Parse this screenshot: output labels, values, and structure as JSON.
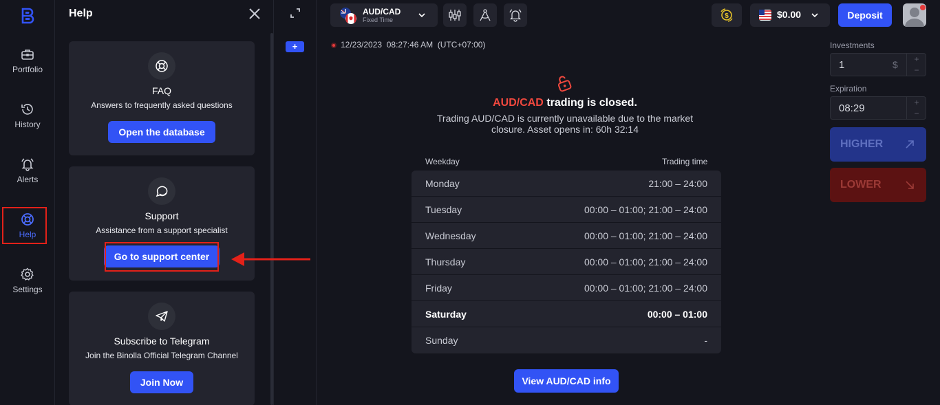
{
  "nav": {
    "items": [
      {
        "label": "Portfolio",
        "icon": "briefcase-icon"
      },
      {
        "label": "History",
        "icon": "history-icon"
      },
      {
        "label": "Alerts",
        "icon": "bell-icon"
      },
      {
        "label": "Help",
        "icon": "lifebuoy-icon"
      },
      {
        "label": "Settings",
        "icon": "gear-icon"
      }
    ]
  },
  "help_panel": {
    "title": "Help",
    "faq": {
      "title": "FAQ",
      "subtitle": "Answers to frequently asked questions",
      "button": "Open the database"
    },
    "support": {
      "title": "Support",
      "subtitle": "Assistance from a support specialist",
      "button": "Go to support center"
    },
    "telegram": {
      "title": "Subscribe to Telegram",
      "subtitle": "Join the Binolla Official Telegram Channel",
      "button": "Join Now"
    }
  },
  "col2": {
    "add_label": "+"
  },
  "header": {
    "asset": {
      "name": "AUD/CAD",
      "type": "Fixed Time"
    },
    "balance": "$0.00",
    "deposit": "Deposit"
  },
  "main": {
    "datetime": "12/23/2023  08:27:46 AM  (UTC+07:00)",
    "closed_asset": "AUD/CAD",
    "closed_text": "trading is closed.",
    "closed_desc": "Trading AUD/CAD is currently unavailable due to the market closure. Asset opens in: 60h 32:14",
    "table": {
      "col_weekday": "Weekday",
      "col_time": "Trading time",
      "rows": [
        {
          "day": "Monday",
          "time": "21:00 – 24:00"
        },
        {
          "day": "Tuesday",
          "time": "00:00 – 01:00; 21:00 – 24:00"
        },
        {
          "day": "Wednesday",
          "time": "00:00 – 01:00; 21:00 – 24:00"
        },
        {
          "day": "Thursday",
          "time": "00:00 – 01:00; 21:00 – 24:00"
        },
        {
          "day": "Friday",
          "time": "00:00 – 01:00; 21:00 – 24:00"
        },
        {
          "day": "Saturday",
          "time": "00:00 – 01:00"
        },
        {
          "day": "Sunday",
          "time": "-"
        }
      ]
    },
    "view_button": "View AUD/CAD info"
  },
  "trade": {
    "investments_label": "Investments",
    "investments_value": "1",
    "investments_unit": "$",
    "expiration_label": "Expiration",
    "expiration_value": "08:29",
    "plus": "+",
    "minus": "−",
    "higher": "HIGHER",
    "lower": "LOWER"
  },
  "colors": {
    "accent": "#3253f5",
    "highlight_red": "#e32119",
    "background": "#14151d",
    "card": "#23242e"
  }
}
